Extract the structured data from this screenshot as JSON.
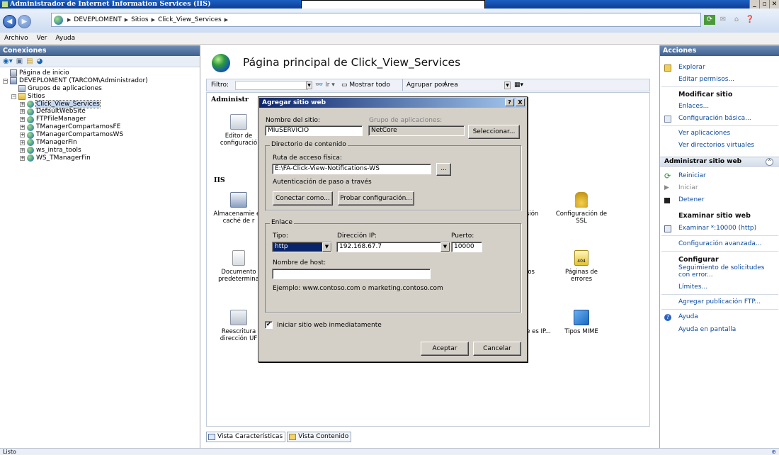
{
  "window": {
    "title": "Administrador de Internet Information Services (IIS)",
    "min": "_",
    "max": "▫",
    "close": "✕"
  },
  "address": {
    "crumbs": [
      "DEVEPLOMENT",
      "Sitios",
      "Click_View_Services"
    ]
  },
  "menu": {
    "items": [
      "Archivo",
      "Ver",
      "Ayuda"
    ]
  },
  "connections": {
    "header": "Conexiones",
    "tree": [
      {
        "label": "Página de inicio",
        "icon": "home-icon",
        "level": 0,
        "expander": ""
      },
      {
        "label": "DEVEPLOMENT (TARCOM\\Administrador)",
        "icon": "server-icon",
        "level": 0,
        "expander": "−"
      },
      {
        "label": "Grupos de aplicaciones",
        "icon": "app-pool-icon",
        "level": 1,
        "expander": ""
      },
      {
        "label": "Sitios",
        "icon": "folder-icon",
        "level": 1,
        "expander": "−"
      },
      {
        "label": "Click_View_Services",
        "icon": "globe-icon",
        "level": 2,
        "expander": "+",
        "selected": true
      },
      {
        "label": "DefaultWebSite",
        "icon": "globe-icon",
        "level": 2,
        "expander": "+"
      },
      {
        "label": "FTPFileManager",
        "icon": "globe-icon",
        "level": 2,
        "expander": "+"
      },
      {
        "label": "TManagerCompartamosFE",
        "icon": "globe-icon",
        "level": 2,
        "expander": "+"
      },
      {
        "label": "TManagerCompartamosWS",
        "icon": "globe-icon",
        "level": 2,
        "expander": "+"
      },
      {
        "label": "TManagerFin",
        "icon": "globe-icon",
        "level": 2,
        "expander": "+"
      },
      {
        "label": "ws_intra_tools",
        "icon": "globe-icon",
        "level": 2,
        "expander": "+"
      },
      {
        "label": "WS_TManagerFin",
        "icon": "globe-icon",
        "level": 2,
        "expander": "+"
      }
    ]
  },
  "center": {
    "title": "Página principal de Click_View_Services",
    "filter_label": "Filtro:",
    "go_label": "Ir",
    "show_all": "Mostrar todo",
    "group_by_label": "Agrupar por:",
    "group_by_value": "Área",
    "group_admin": "Administr",
    "group_iis": "IIS",
    "features": {
      "editor": "Editor de configuració",
      "cache": "Almacenamie en caché de r",
      "sesion": "esión",
      "ssl": "Configuración de SSL",
      "documento": "Documento predetermina",
      "modulos": "los",
      "errores": "Páginas de errores",
      "reescritura": "Reescritura dirección UF",
      "restricciones": "nes de es IP...",
      "mime": "Tipos MIME"
    },
    "tabs": [
      "Vista Características",
      "Vista Contenido"
    ]
  },
  "status": {
    "text": "Listo"
  },
  "actions": {
    "header": "Acciones",
    "explorar": "Explorar",
    "editar_permisos": "Editar permisos...",
    "modificar_sitio": "Modificar sitio",
    "enlaces": "Enlaces...",
    "config_basica": "Configuración básica...",
    "ver_aplicaciones": "Ver aplicaciones",
    "ver_directorios": "Ver directorios virtuales",
    "admin_group": "Administrar sitio web",
    "reiniciar": "Reiniciar",
    "iniciar": "Iniciar",
    "detener": "Detener",
    "examinar_h": "Examinar sitio web",
    "examinar_link": "Examinar *:10000 (http)",
    "config_avanzada": "Configuración avanzada...",
    "configurar_h": "Configurar",
    "seguimiento": "Seguimiento de solicitudes con error...",
    "limites": "Límites...",
    "ftp": "Agregar publicación FTP...",
    "ayuda": "Ayuda",
    "ayuda_pantalla": "Ayuda en pantalla"
  },
  "dialog": {
    "title": "Agregar sitio web",
    "help_btn": "?",
    "close_btn": "X",
    "site_name_label": "Nombre del sitio:",
    "site_name_value": "MIuSERVICIO",
    "app_pool_label": "Grupo de aplicaciones:",
    "app_pool_value": "NetCore",
    "select_btn": "Seleccionar...",
    "content_group": "Directorio de contenido",
    "physical_path_label": "Ruta de acceso física:",
    "physical_path_value": "E:\\FA-Click-View-Notifications-WS",
    "browse_btn": "...",
    "passthrough_label": "Autenticación de paso a través",
    "connect_as_btn": "Conectar como...",
    "test_config_btn": "Probar configuración...",
    "binding_group": "Enlace",
    "type_label": "Tipo:",
    "type_value": "http",
    "ip_label": "Dirección IP:",
    "ip_value": "192.168.67.7",
    "port_label": "Puerto:",
    "port_value": "10000",
    "host_label": "Nombre de host:",
    "host_value": "",
    "example_text": "Ejemplo: www.contoso.com o marketing.contoso.com",
    "start_checkbox_label": "Iniciar sitio web inmediatamente",
    "start_checked": "✔",
    "accept_btn": "Aceptar",
    "cancel_btn": "Cancelar"
  }
}
